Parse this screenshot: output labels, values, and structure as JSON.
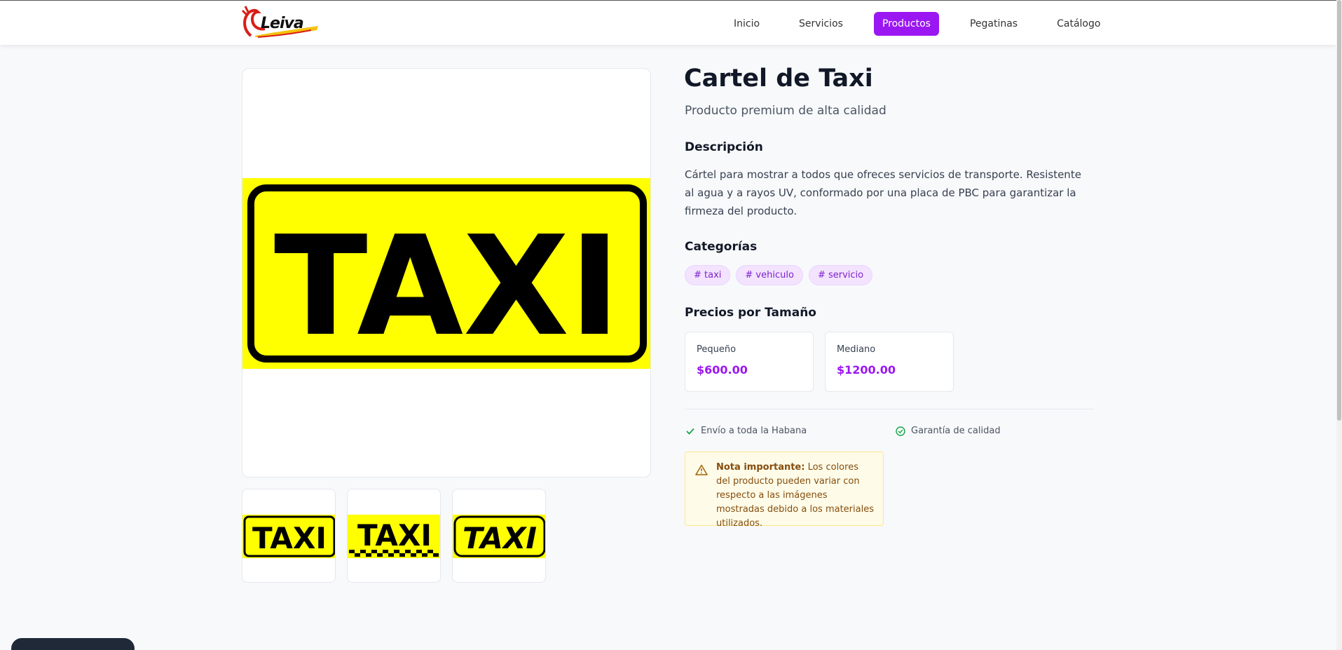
{
  "header": {
    "logo_text": "Leiva",
    "nav": [
      "Inicio",
      "Servicios",
      "Productos",
      "Pegatinas",
      "Catálogo"
    ],
    "active_nav": "Productos"
  },
  "product": {
    "title": "Cartel de Taxi",
    "subtitle": "Producto premium de alta calidad",
    "description_heading": "Descripción",
    "description": "Cártel para mostrar a todos que ofreces servicios de transporte. Resistente al agua y a rayos UV, conformado por una placa de PBC para garantizar la firmeza del producto.",
    "categories_heading": "Categorías",
    "categories": [
      "# taxi",
      "# vehiculo",
      "# servicio"
    ],
    "prices_heading": "Precios por Tamaño",
    "prices": [
      {
        "label": "Pequeño",
        "value": "$600.00"
      },
      {
        "label": "Mediano",
        "value": "$1200.00"
      }
    ],
    "features": [
      "Envío a toda la Habana",
      "Garantía de calidad"
    ],
    "note_label": "Nota importante:",
    "note_text": "Los colores del producto pueden variar con respecto a las imágenes mostradas debido a los materiales utilizados.",
    "sign_text": "TAXI"
  },
  "colors": {
    "accent": "#9b17f2",
    "sign_yellow": "#ffff00",
    "check_green": "#16a34a"
  }
}
